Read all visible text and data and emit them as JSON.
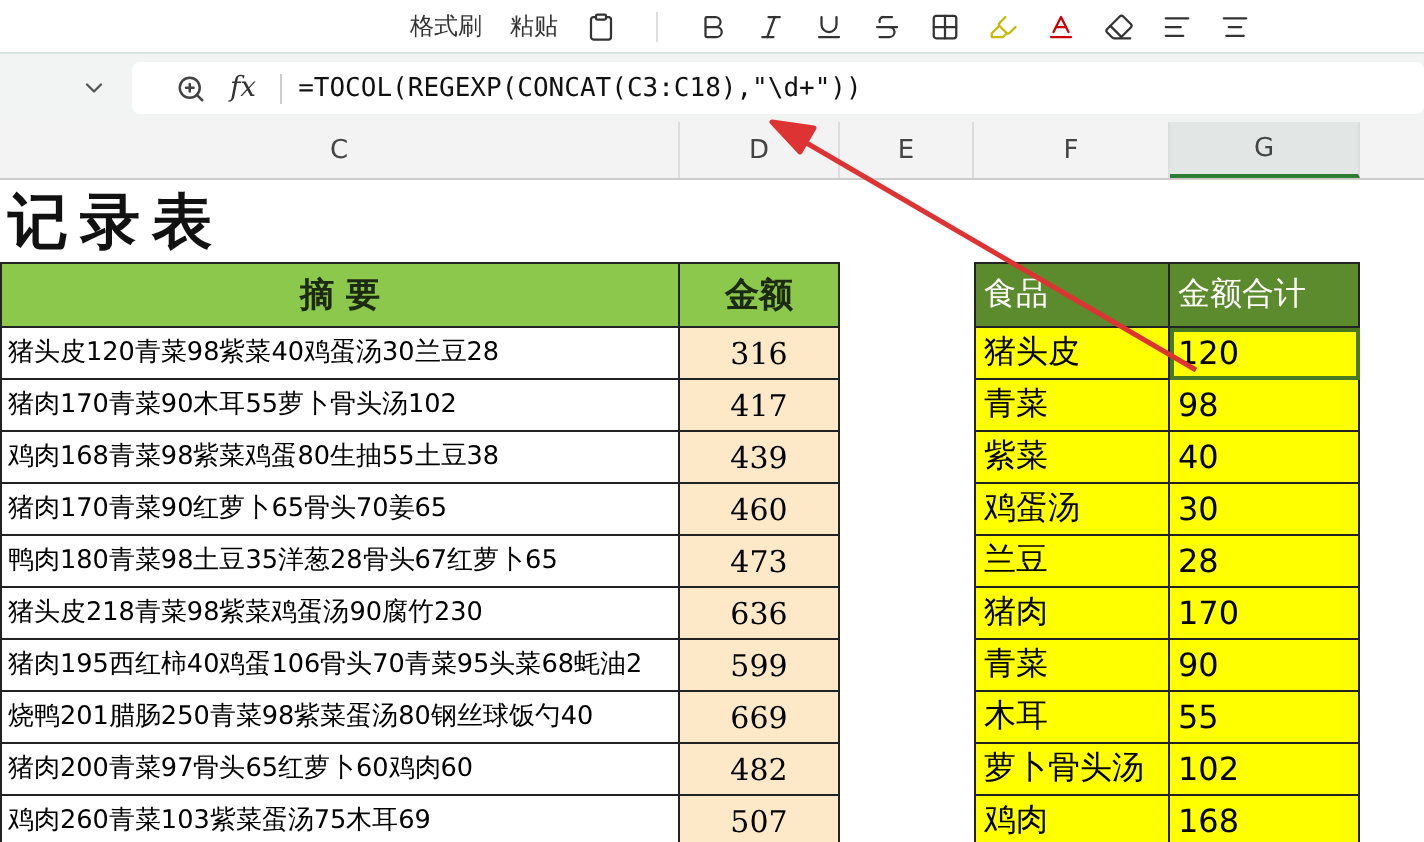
{
  "ribbon": {
    "labels": [
      "格式刷",
      "粘贴"
    ]
  },
  "formula_bar": {
    "fx_label": "fx",
    "formula": "=TOCOL(REGEXP(CONCAT(C3:C18),\"\\d+\"))"
  },
  "column_headers": [
    {
      "label": "C",
      "selected": false
    },
    {
      "label": "D",
      "selected": false
    },
    {
      "label": "E",
      "selected": false
    },
    {
      "label": "F",
      "selected": false
    },
    {
      "label": "G",
      "selected": true
    }
  ],
  "sheet": {
    "title": "记录表",
    "summary_table": {
      "columns": [
        "摘 要",
        "金额"
      ],
      "rows": [
        {
          "summary": "猪头皮120青菜98紫菜40鸡蛋汤30兰豆28",
          "amount": "316"
        },
        {
          "summary": "猪肉170青菜90木耳55萝卜骨头汤102",
          "amount": "417"
        },
        {
          "summary": "鸡肉168青菜98紫菜鸡蛋80生抽55土豆38",
          "amount": "439"
        },
        {
          "summary": "猪肉170青菜90红萝卜65骨头70姜65",
          "amount": "460"
        },
        {
          "summary": "鸭肉180青菜98土豆35洋葱28骨头67红萝卜65",
          "amount": "473"
        },
        {
          "summary": "猪头皮218青菜98紫菜鸡蛋汤90腐竹230",
          "amount": "636"
        },
        {
          "summary": "猪肉195西红柿40鸡蛋106骨头70青菜95头菜68蚝油2",
          "amount": "599"
        },
        {
          "summary": "烧鸭201腊肠250青菜98紫菜蛋汤80钢丝球饭勺40",
          "amount": "669"
        },
        {
          "summary": "猪肉200青菜97骨头65红萝卜60鸡肉60",
          "amount": "482"
        },
        {
          "summary": "鸡肉260青菜103紫菜蛋汤75木耳69",
          "amount": "507"
        }
      ]
    },
    "food_table": {
      "columns": [
        "食品",
        "金额合计"
      ],
      "rows": [
        {
          "food": "猪头皮",
          "total": "120",
          "selected": true
        },
        {
          "food": "青菜",
          "total": "98",
          "selected": false
        },
        {
          "food": "紫菜",
          "total": "40",
          "selected": false
        },
        {
          "food": "鸡蛋汤",
          "total": "30",
          "selected": false
        },
        {
          "food": "兰豆",
          "total": "28",
          "selected": false
        },
        {
          "food": "猪肉",
          "total": "170",
          "selected": false
        },
        {
          "food": "青菜",
          "total": "90",
          "selected": false
        },
        {
          "food": "木耳",
          "total": "55",
          "selected": false
        },
        {
          "food": "萝卜骨头汤",
          "total": "102",
          "selected": false
        },
        {
          "food": "鸡肉",
          "total": "168",
          "selected": false
        }
      ]
    }
  }
}
